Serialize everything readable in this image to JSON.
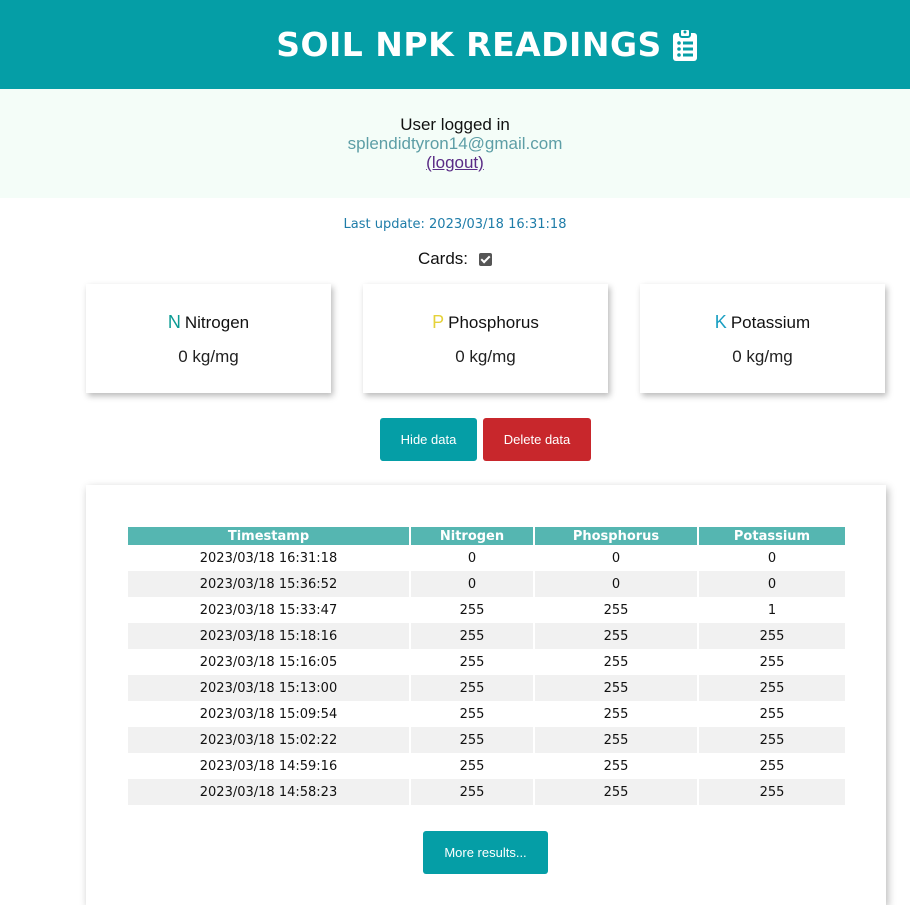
{
  "header": {
    "title": "SOIL NPK READINGS",
    "icon": "clipboard-list-icon"
  },
  "auth": {
    "login_label": "User logged in",
    "email": "splendidtyron14@gmail.com",
    "logout_label": "(logout)"
  },
  "last_update": "Last update: 2023/03/18 16:31:18",
  "cards_toggle": {
    "label": "Cards:",
    "checked": true
  },
  "cards": [
    {
      "letter": "N",
      "name": "Nitrogen",
      "value": "0 kg/mg",
      "color": "#0c9b94"
    },
    {
      "letter": "P",
      "name": "Phosphorus",
      "value": "0 kg/mg",
      "color": "#e5d23a"
    },
    {
      "letter": "K",
      "name": "Potassium",
      "value": "0 kg/mg",
      "color": "#1a9fc2"
    }
  ],
  "buttons": {
    "hide": "Hide data",
    "delete": "Delete data",
    "more": "More results..."
  },
  "table": {
    "headers": [
      "Timestamp",
      "Nitrogen",
      "Phosphorus",
      "Potassium"
    ],
    "rows": [
      [
        "2023/03/18 16:31:18",
        "0",
        "0",
        "0"
      ],
      [
        "2023/03/18 15:36:52",
        "0",
        "0",
        "0"
      ],
      [
        "2023/03/18 15:33:47",
        "255",
        "255",
        "1"
      ],
      [
        "2023/03/18 15:18:16",
        "255",
        "255",
        "255"
      ],
      [
        "2023/03/18 15:16:05",
        "255",
        "255",
        "255"
      ],
      [
        "2023/03/18 15:13:00",
        "255",
        "255",
        "255"
      ],
      [
        "2023/03/18 15:09:54",
        "255",
        "255",
        "255"
      ],
      [
        "2023/03/18 15:02:22",
        "255",
        "255",
        "255"
      ],
      [
        "2023/03/18 14:59:16",
        "255",
        "255",
        "255"
      ],
      [
        "2023/03/18 14:58:23",
        "255",
        "255",
        "255"
      ]
    ]
  },
  "colors": {
    "primary": "#059ea6",
    "danger": "#c8272c",
    "table_header": "#55b6b1",
    "auth_bg": "#f4fdf8"
  }
}
